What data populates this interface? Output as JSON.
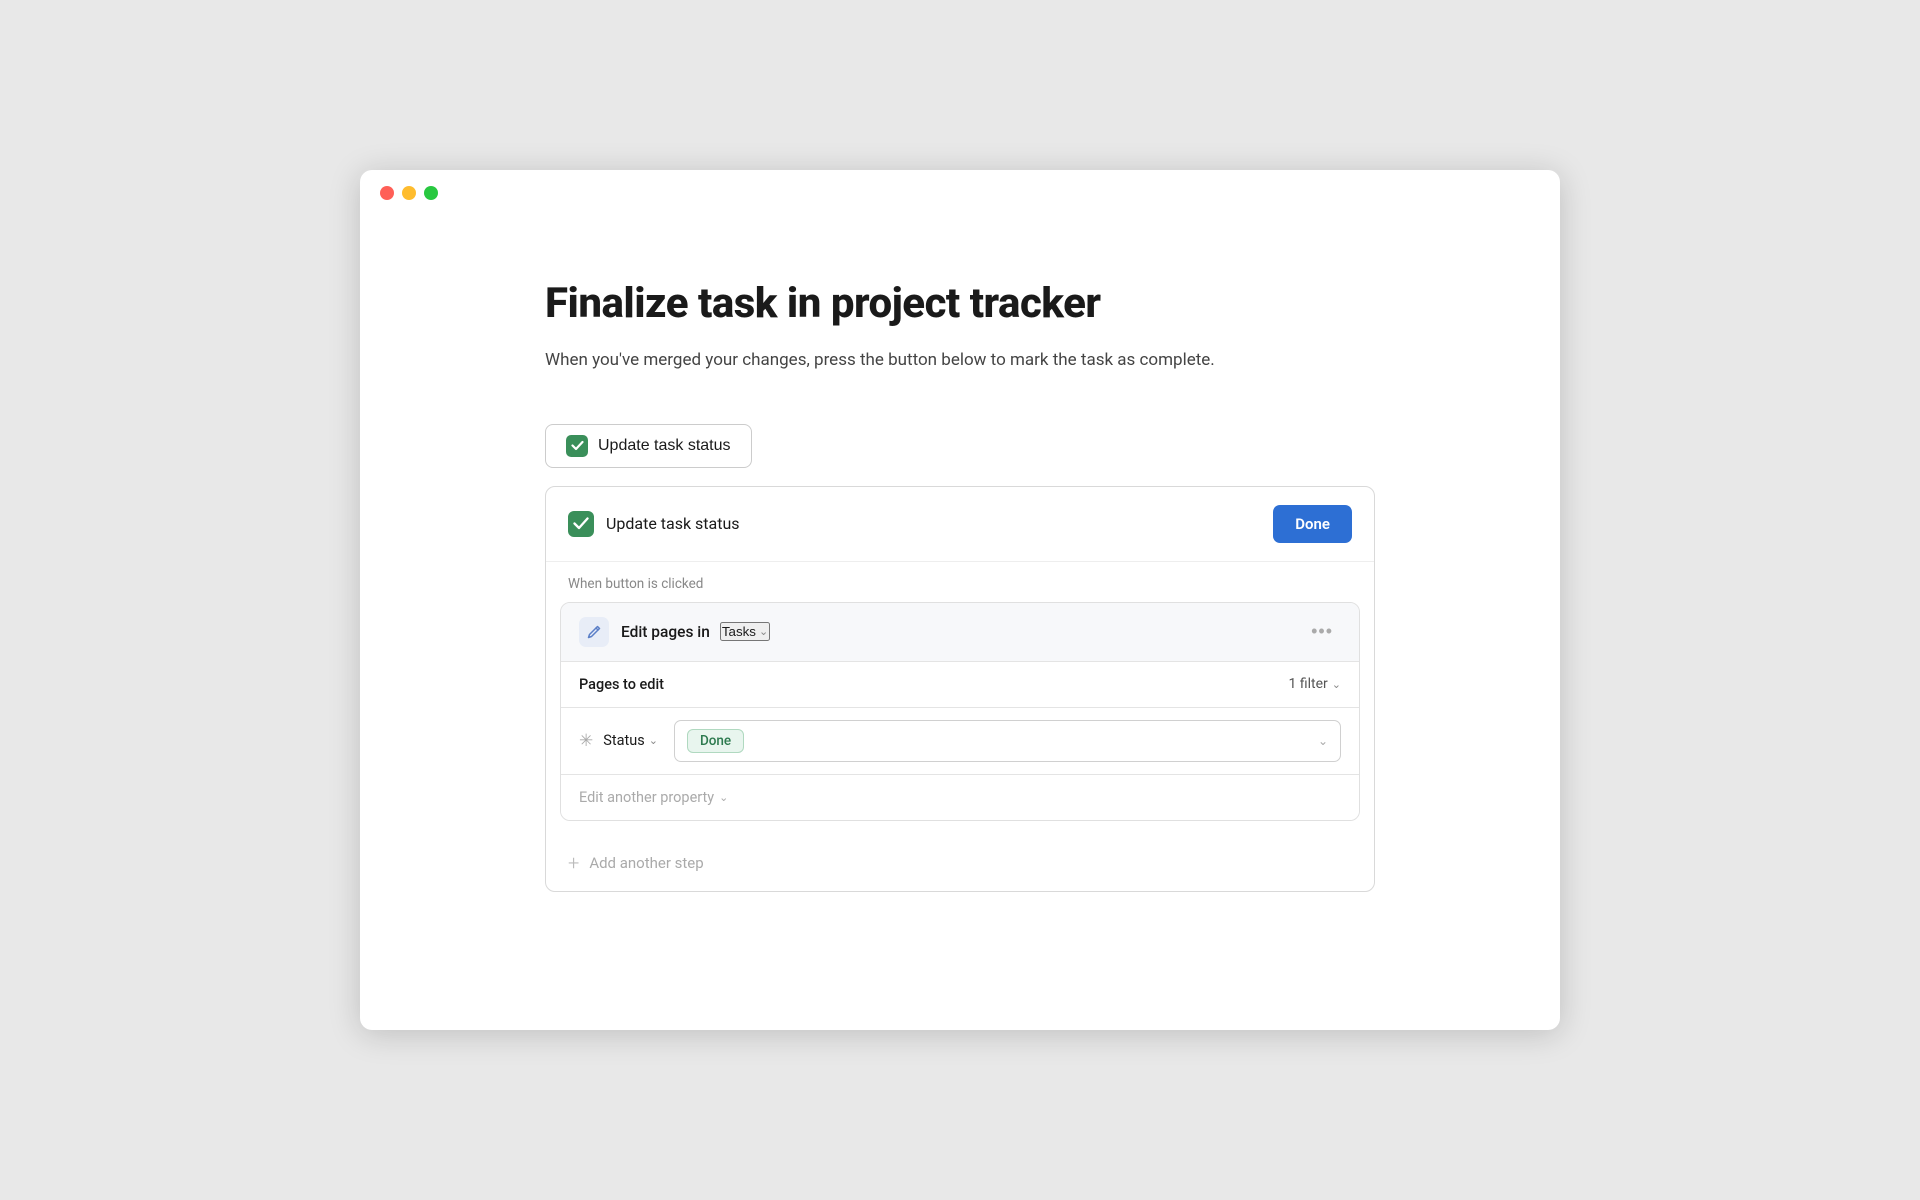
{
  "window": {
    "dots": [
      "red",
      "yellow",
      "green"
    ]
  },
  "page": {
    "title": "Finalize task in project tracker",
    "description": "When you've merged your changes, press the button below to mark the task as complete."
  },
  "taskStatusBtn": {
    "label": "Update task status"
  },
  "card": {
    "inputValue": "Update task status",
    "doneLabel": "Done",
    "whenLabel": "When button is clicked"
  },
  "step": {
    "editPagesPrefix": "Edit pages in",
    "editPagesTasks": "Tasks",
    "pagesLabel": "Pages to edit",
    "filterLabel": "1 filter",
    "statusLabel": "Status",
    "statusValue": "Done",
    "editAnotherLabel": "Edit another property",
    "addStepLabel": "Add another step"
  }
}
